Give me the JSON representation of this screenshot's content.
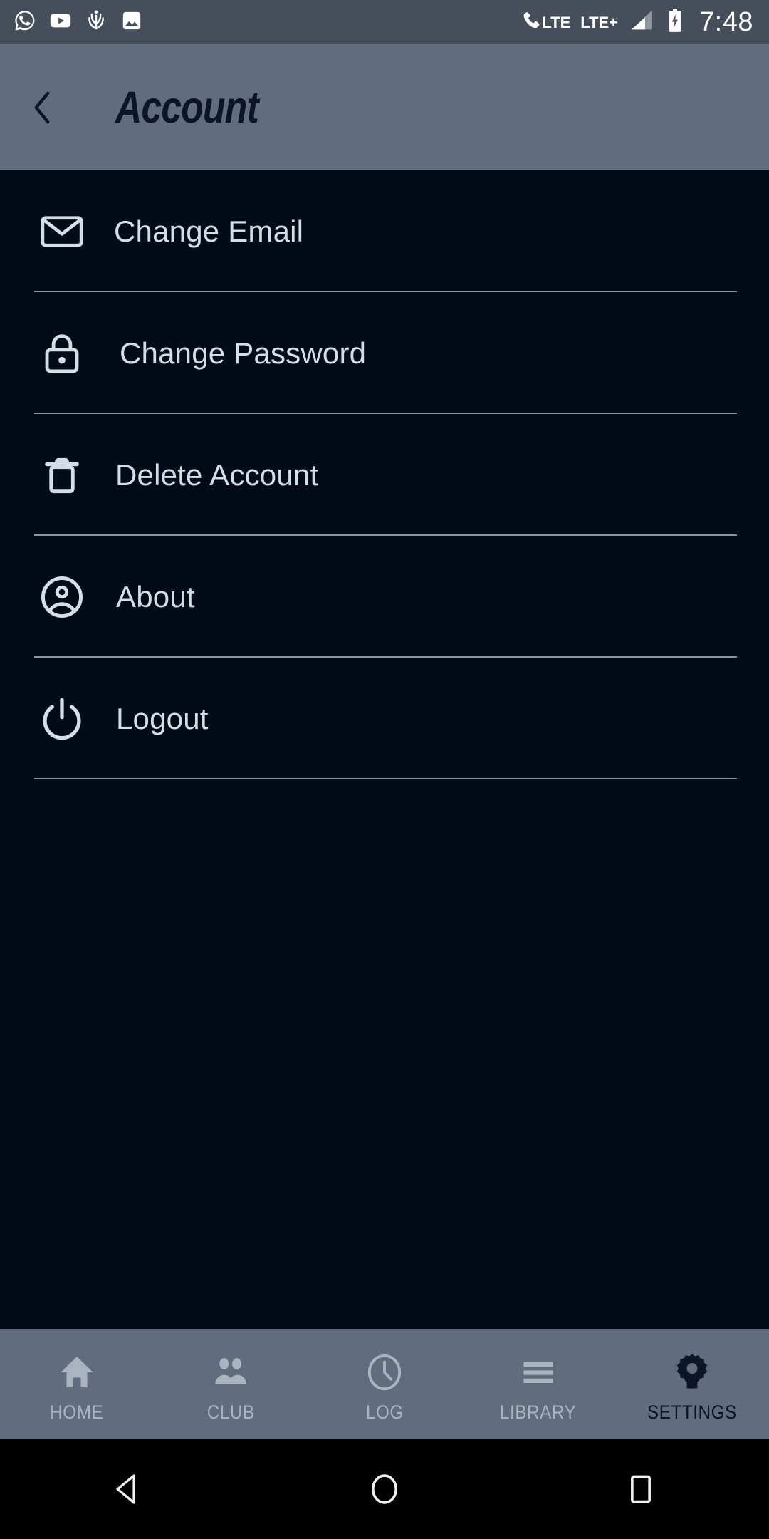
{
  "status_bar": {
    "notifications": [
      {
        "name": "whatsapp-icon",
        "label": "WhatsApp"
      },
      {
        "name": "youtube-icon",
        "label": "YouTube"
      },
      {
        "name": "app-notification-icon",
        "label": "App"
      },
      {
        "name": "gallery-icon",
        "label": "Gallery"
      }
    ],
    "volte_label": "LTE",
    "network_label": "LTE+",
    "clock": "7:48",
    "battery_state": "charging",
    "background_color": "#464e5c",
    "foreground_color": "#ffffff"
  },
  "header": {
    "title": "Account",
    "back_label": "Back",
    "background_color": "#616c7f",
    "title_color": "#0b1526"
  },
  "account_menu": {
    "items": [
      {
        "label": "Change Email",
        "icon": "mail-icon",
        "indent": 188
      },
      {
        "label": "Change Password",
        "icon": "lock-icon",
        "indent": 196
      },
      {
        "label": "Delete Account",
        "icon": "trash-icon",
        "indent": 190
      },
      {
        "label": "About",
        "icon": "account-circle-icon",
        "indent": 191
      },
      {
        "label": "Logout",
        "icon": "power-icon",
        "indent": 191
      }
    ],
    "background_color": "#020a16",
    "label_color": "#d5dde6",
    "divider_color": "#8a96a6"
  },
  "bottom_nav": {
    "items": [
      {
        "label": "HOME",
        "icon": "home-icon",
        "active": false
      },
      {
        "label": "CLUB",
        "icon": "people-icon",
        "active": false
      },
      {
        "label": "LOG",
        "icon": "clock-icon",
        "active": false
      },
      {
        "label": "LIBRARY",
        "icon": "list-icon",
        "active": false
      },
      {
        "label": "SETTINGS",
        "icon": "gear-icon",
        "active": true
      }
    ],
    "background_color": "#616c7f",
    "inactive_color": "#aab3c0",
    "active_color": "#0b1526"
  },
  "android_nav": {
    "back_label": "Back",
    "home_label": "Home",
    "recents_label": "Recents",
    "background_color": "#000000"
  }
}
